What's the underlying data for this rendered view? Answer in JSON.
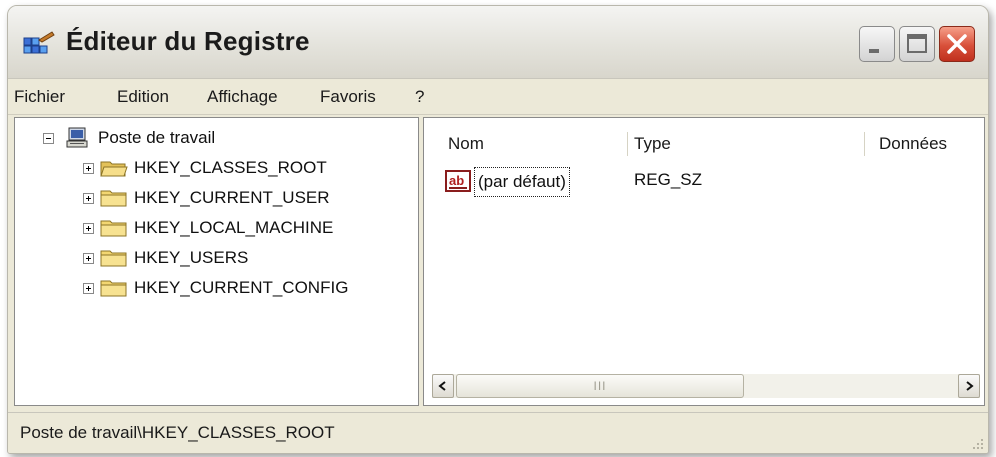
{
  "window": {
    "title": "Éditeur du Registre"
  },
  "menu": [
    "Fichier",
    "Edition",
    "Affichage",
    "Favoris",
    "?"
  ],
  "tree": {
    "root": "Poste de travail",
    "children": [
      "HKEY_CLASSES_ROOT",
      "HKEY_CURRENT_USER",
      "HKEY_LOCAL_MACHINE",
      "HKEY_USERS",
      "HKEY_CURRENT_CONFIG"
    ]
  },
  "list": {
    "columns": [
      "Nom",
      "Type",
      "Données"
    ],
    "rows": [
      {
        "name": "(par défaut)",
        "type": "REG_SZ",
        "data": ""
      }
    ],
    "scroll_thumb_label": "III"
  },
  "status": {
    "path": "Poste de travail\\HKEY_CLASSES_ROOT"
  },
  "icons": {
    "app": "registry-editor-icon",
    "computer": "computer-icon",
    "folder": "folder-icon",
    "value": "string-value-ab-icon"
  },
  "colors": {
    "window_bg": "#ece9d8",
    "close_button": "#d8503a",
    "folder": "#f3d671"
  }
}
